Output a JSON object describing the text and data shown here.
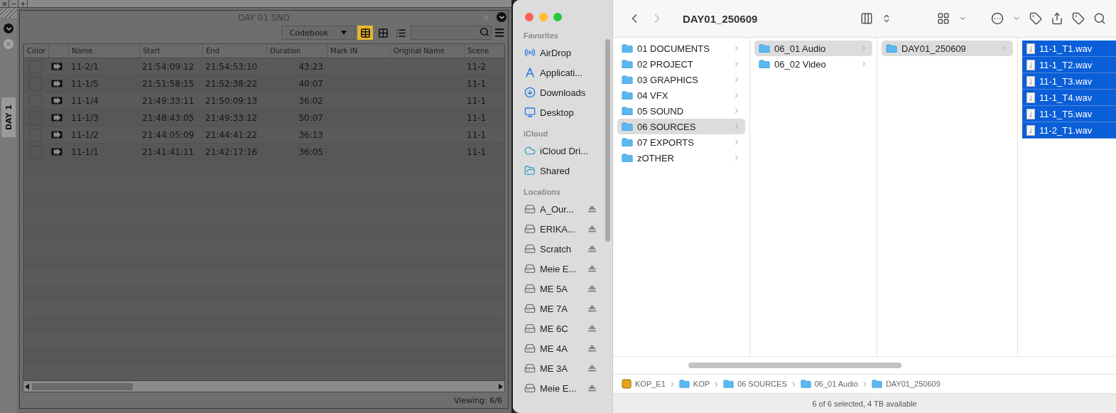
{
  "editor": {
    "side_tab": {
      "label": "DAY 1"
    },
    "bin": {
      "title": "DAY 01 SND",
      "view_menu": "Codebook",
      "view_modes": [
        {
          "kind": "frame",
          "selected": true
        },
        {
          "kind": "grid",
          "selected": false
        },
        {
          "kind": "list",
          "selected": false
        }
      ],
      "columns": [
        "Color",
        "Name",
        "Start",
        "End",
        "Duration",
        "Mark IN",
        "Original Name",
        "Scene"
      ],
      "rows": [
        {
          "name": "11-2/1",
          "start": "21:54:09:12",
          "end": "21:54:53:10",
          "duration": "43:23",
          "scene": "11-2"
        },
        {
          "name": "11-1/5",
          "start": "21:51:58:15",
          "end": "21:52:38:22",
          "duration": "40:07",
          "scene": "11-1"
        },
        {
          "name": "11-1/4",
          "start": "21:49:33:11",
          "end": "21:50:09:13",
          "duration": "36:02",
          "scene": "11-1"
        },
        {
          "name": "11-1/3",
          "start": "21:48:43:05",
          "end": "21:49:33:12",
          "duration": "50:07",
          "scene": "11-1"
        },
        {
          "name": "11-1/2",
          "start": "21:44:05:09",
          "end": "21:44:41:22",
          "duration": "36:13",
          "scene": "11-1"
        },
        {
          "name": "11-1/1",
          "start": "21:41:41:11",
          "end": "21:42:17:16",
          "duration": "36:05",
          "scene": "11-1"
        }
      ],
      "footer": "Viewing: 6/6"
    }
  },
  "finder": {
    "title": "DAY01_250609",
    "sidebar": [
      {
        "heading": "Favorites",
        "items": [
          {
            "label": "AirDrop",
            "kind": "airdrop"
          },
          {
            "label": "Applicati...",
            "kind": "apps"
          },
          {
            "label": "Downloads",
            "kind": "downloads"
          },
          {
            "label": "Desktop",
            "kind": "desktop"
          }
        ]
      },
      {
        "heading": "iCloud",
        "items": [
          {
            "label": "iCloud Dri...",
            "kind": "cloud"
          },
          {
            "label": "Shared",
            "kind": "shared"
          }
        ]
      },
      {
        "heading": "Locations",
        "items": [
          {
            "label": "A_Our...",
            "kind": "drive"
          },
          {
            "label": "ERIKA...",
            "kind": "drive"
          },
          {
            "label": "Scratch",
            "kind": "drive"
          },
          {
            "label": "Meie E...",
            "kind": "drive"
          },
          {
            "label": "ME 5A",
            "kind": "drive"
          },
          {
            "label": "ME 7A",
            "kind": "drive"
          },
          {
            "label": "ME 6C",
            "kind": "drive"
          },
          {
            "label": "ME 4A",
            "kind": "drive"
          },
          {
            "label": "ME 3A",
            "kind": "drive"
          },
          {
            "label": "Meie E...",
            "kind": "drive"
          }
        ]
      }
    ],
    "columns": [
      {
        "active": false,
        "items": [
          {
            "label": "01 DOCUMENTS",
            "kind": "folder",
            "selected": false
          },
          {
            "label": "02 PROJECT",
            "kind": "folder",
            "selected": false
          },
          {
            "label": "03 GRAPHICS",
            "kind": "folder",
            "selected": false
          },
          {
            "label": "04 VFX",
            "kind": "folder",
            "selected": false
          },
          {
            "label": "05 SOUND",
            "kind": "folder",
            "selected": false
          },
          {
            "label": "06 SOURCES",
            "kind": "folder",
            "selected": true
          },
          {
            "label": "07 EXPORTS",
            "kind": "folder",
            "selected": false
          },
          {
            "label": "zOTHER",
            "kind": "folder",
            "selected": false
          }
        ]
      },
      {
        "active": false,
        "items": [
          {
            "label": "06_01 Audio",
            "kind": "folder",
            "selected": true
          },
          {
            "label": "06_02 Video",
            "kind": "folder",
            "selected": false
          }
        ]
      },
      {
        "active": false,
        "items": [
          {
            "label": "DAY01_250609",
            "kind": "folder",
            "selected": true
          }
        ]
      },
      {
        "active": true,
        "items": [
          {
            "label": "11-1_T1.wav",
            "kind": "file",
            "selected": true
          },
          {
            "label": "11-1_T2.wav",
            "kind": "file",
            "selected": true
          },
          {
            "label": "11-1_T3.wav",
            "kind": "file",
            "selected": true
          },
          {
            "label": "11-1_T4.wav",
            "kind": "file",
            "selected": true
          },
          {
            "label": "11-1_T5.wav",
            "kind": "file",
            "selected": true
          },
          {
            "label": "11-2_T1.wav",
            "kind": "file",
            "selected": true
          }
        ]
      }
    ],
    "path": [
      {
        "label": "KOP_E1",
        "kind": "drive"
      },
      {
        "label": "KOP",
        "kind": "folder"
      },
      {
        "label": "06 SOURCES",
        "kind": "folder"
      },
      {
        "label": "06_01 Audio",
        "kind": "folder"
      },
      {
        "label": "DAY01_250609",
        "kind": "folder"
      }
    ],
    "status": "6 of 6 selected, 4 TB available"
  }
}
